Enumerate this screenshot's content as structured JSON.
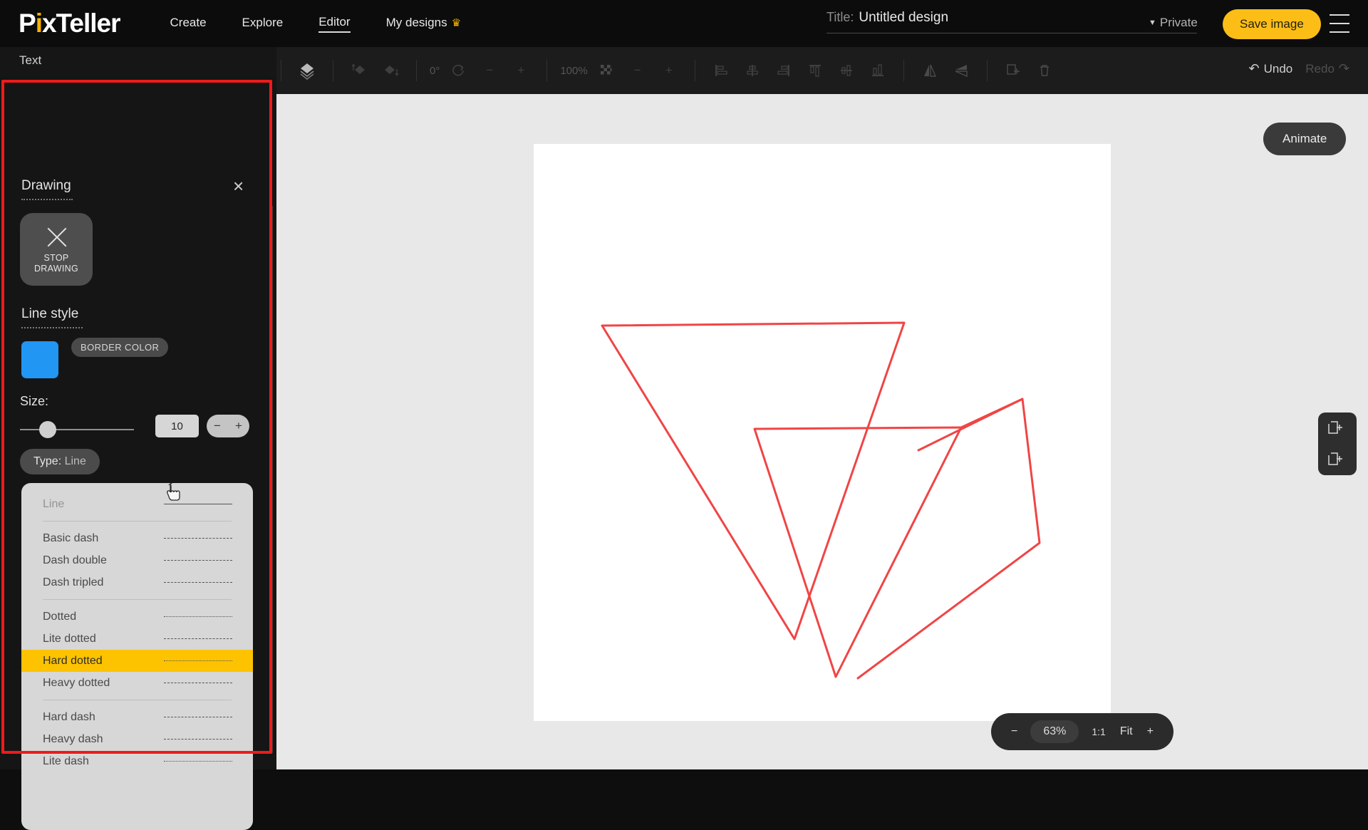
{
  "brand": {
    "name_part1": "P",
    "name_dot": "i",
    "name_part2": "x",
    "name_part3": "Teller",
    "full": "PixTeller"
  },
  "nav": {
    "items": [
      {
        "label": "Create",
        "active": false
      },
      {
        "label": "Explore",
        "active": false
      },
      {
        "label": "Editor",
        "active": true
      },
      {
        "label": "My designs",
        "active": false,
        "badge": "crown"
      }
    ]
  },
  "header": {
    "title_label": "Title:",
    "title_value": "Untitled design",
    "privacy": "Private",
    "privacy_caret": "▼",
    "save_label": "Save image",
    "menu_icon": "hamburger-icon"
  },
  "left_rail": {
    "tab_label": "Text"
  },
  "panel": {
    "heading": "Drawing",
    "close_icon": "×",
    "stop_drawing": {
      "icon": "x-icon",
      "line1": "STOP",
      "line2": "DRAWING"
    },
    "line_style_heading": "Line style",
    "border_color_label": "BORDER COLOR",
    "border_color_value": "#2196f3",
    "size_label": "Size:",
    "size_value": "10",
    "minus_label": "−",
    "plus_label": "+",
    "type_prefix": "Type:",
    "type_value": "Line"
  },
  "dropdown": {
    "groups": [
      {
        "items": [
          {
            "label": "Line",
            "style": "pv-solid",
            "state": "selected"
          }
        ]
      },
      {
        "items": [
          {
            "label": "Basic dash",
            "style": "pv-basicdash",
            "state": "normal"
          },
          {
            "label": "Dash double",
            "style": "pv-dashdouble",
            "state": "normal"
          },
          {
            "label": "Dash tripled",
            "style": "pv-dashtripled",
            "state": "normal"
          }
        ]
      },
      {
        "items": [
          {
            "label": "Dotted",
            "style": "pv-dotted",
            "state": "normal"
          },
          {
            "label": "Lite dotted",
            "style": "pv-litedotted",
            "state": "normal"
          },
          {
            "label": "Hard dotted",
            "style": "pv-harddotted",
            "state": "highlighted"
          },
          {
            "label": "Heavy dotted",
            "style": "pv-heavydotted",
            "state": "normal"
          }
        ]
      },
      {
        "items": [
          {
            "label": "Hard dash",
            "style": "pv-harddash",
            "state": "normal"
          },
          {
            "label": "Heavy dash",
            "style": "pv-heavydash",
            "state": "normal"
          },
          {
            "label": "Lite dash",
            "style": "pv-litedash",
            "state": "normal"
          }
        ]
      }
    ]
  },
  "toolbar": {
    "layers_icon": "layers-icon",
    "bring_forward_icon": "bring-forward-icon",
    "send_backward_icon": "send-backward-icon",
    "rotation_value": "0°",
    "rotate_icon": "rotate-icon",
    "rotate_minus": "−",
    "rotate_plus": "+",
    "opacity_value": "100%",
    "opacity_icon": "checkerboard-icon",
    "opacity_minus": "−",
    "opacity_plus": "+",
    "align_left_icon": "align-left-icon",
    "align_center_icon": "align-center-icon",
    "align_right_icon": "align-right-icon",
    "align_top_icon": "align-top-icon",
    "align_middle_icon": "align-middle-icon",
    "align_bottom_icon": "align-bottom-icon",
    "flip_h_icon": "flip-horizontal-icon",
    "flip_v_icon": "flip-vertical-icon",
    "duplicate_icon": "duplicate-icon",
    "delete_icon": "trash-icon",
    "undo_label": "Undo",
    "redo_label": "Redo",
    "undo_icon": "undo-arrow-icon",
    "redo_icon": "redo-arrow-icon"
  },
  "canvas": {
    "animate_label": "Animate",
    "add_page_icon": "add-page-icon",
    "duplicate_page_icon": "duplicate-page-icon",
    "drawing_stroke_color": "#f04545"
  },
  "zoom_bar": {
    "minus": "−",
    "percent": "63%",
    "one_to_one": "1:1",
    "fit": "Fit",
    "plus": "+"
  },
  "annotation": {
    "highlight_color": "#ef1b1b"
  }
}
